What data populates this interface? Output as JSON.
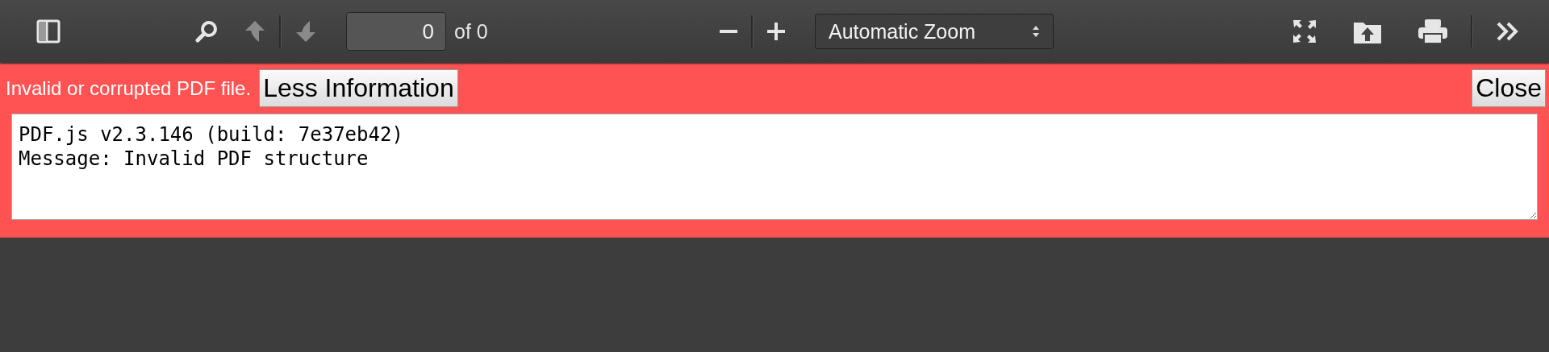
{
  "toolbar": {
    "page_number": "0",
    "page_count": "of 0",
    "zoom": "Automatic Zoom",
    "buttons": [
      {
        "kind": "sidebar",
        "disabled": false
      },
      {
        "kind": "search",
        "disabled": false
      },
      {
        "kind": "up",
        "disabled": true
      },
      {
        "kind": "down",
        "disabled": true
      }
    ]
  },
  "error": {
    "message": "Invalid or corrupted PDF file.",
    "toggle_button": "Less Information",
    "close_button": "Close",
    "details": "PDF.js v2.3.146 (build: 7e37eb42)\nMessage: Invalid PDF structure"
  }
}
